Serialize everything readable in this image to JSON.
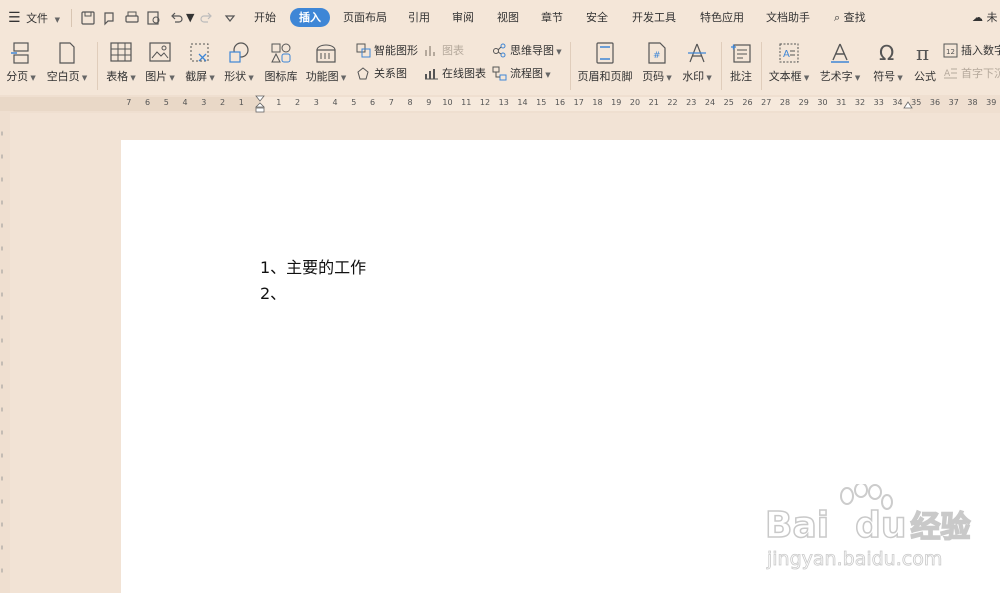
{
  "menubar": {
    "file_label": "文件",
    "tabs": [
      "开始",
      "插入",
      "页面布局",
      "引用",
      "审阅",
      "视图",
      "章节",
      "安全",
      "开发工具",
      "特色应用",
      "文档助手"
    ],
    "active_tab": "插入",
    "search_label": "查找",
    "cloud_label": "未"
  },
  "ribbon": {
    "page_break": "分页",
    "blank_page": "空白页",
    "table": "表格",
    "picture": "图片",
    "screenshot": "截屏",
    "shape": "形状",
    "icon_lib": "图标库",
    "function_chart": "功能图",
    "smart_shape": "智能图形",
    "chart": "图表",
    "relation_chart": "关系图",
    "online_chart": "在线图表",
    "mind_map": "思维导图",
    "flowchart": "流程图",
    "header_footer": "页眉和页脚",
    "page_number": "页码",
    "watermark": "水印",
    "comment": "批注",
    "textbox": "文本框",
    "wordart": "艺术字",
    "symbol": "符号",
    "formula": "公式",
    "insert_number": "插入数字",
    "drop_cap": "首字下沉"
  },
  "ruler": {
    "left_marks": [
      "7",
      "6",
      "5",
      "4",
      "3",
      "2",
      "1"
    ],
    "right_marks": [
      "1",
      "2",
      "3",
      "4",
      "5",
      "6",
      "7",
      "8",
      "9",
      "10",
      "11",
      "12",
      "13",
      "14",
      "15",
      "16",
      "17",
      "18",
      "19",
      "20",
      "21",
      "22",
      "23",
      "24",
      "25",
      "26",
      "27",
      "28",
      "29",
      "30",
      "31",
      "32",
      "33",
      "34",
      "35",
      "36",
      "37",
      "38",
      "39"
    ]
  },
  "document": {
    "lines": [
      "1、主要的工作",
      "2、"
    ]
  },
  "watermark": {
    "brand": "Bai",
    "brand2": "du",
    "cn": "经验",
    "url": "jingyan.baidu.com"
  }
}
